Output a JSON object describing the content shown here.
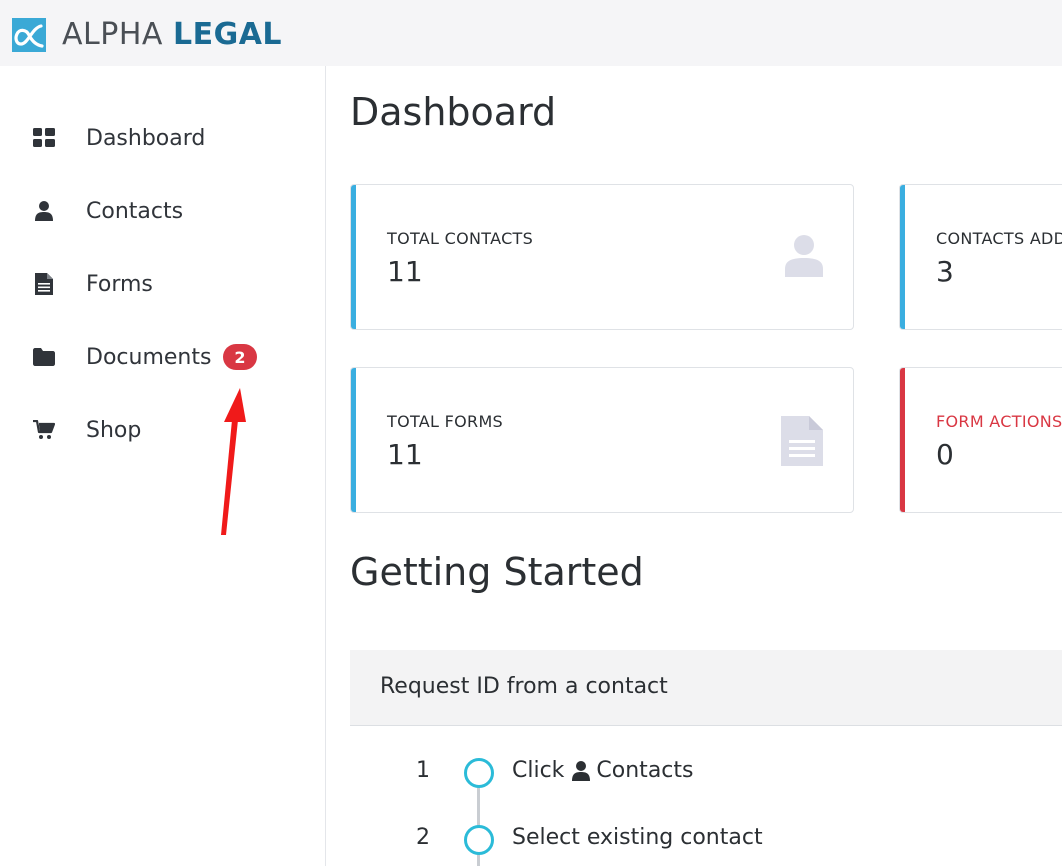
{
  "brand": {
    "name_light": "ALPHA",
    "name_bold": "LEGAL",
    "accent": "#1a6a93",
    "logo_bg": "#3aa9d6"
  },
  "sidebar": {
    "items": [
      {
        "label": "Dashboard",
        "icon": "grid-icon"
      },
      {
        "label": "Contacts",
        "icon": "user-icon"
      },
      {
        "label": "Forms",
        "icon": "document-icon"
      },
      {
        "label": "Documents",
        "icon": "folder-icon",
        "badge": "2"
      },
      {
        "label": "Shop",
        "icon": "cart-icon"
      }
    ]
  },
  "main": {
    "title": "Dashboard",
    "cards": [
      {
        "label": "TOTAL CONTACTS",
        "value": "11",
        "accent": "#3aaee0",
        "icon": "user-icon"
      },
      {
        "label": "CONTACTS ADD",
        "value": "3",
        "accent": "#3aaee0"
      },
      {
        "label": "TOTAL FORMS",
        "value": "11",
        "accent": "#3aaee0",
        "icon": "document-icon"
      },
      {
        "label": "FORM ACTIONS",
        "value": "0",
        "accent": "#d93743",
        "label_color": "#d93743"
      }
    ],
    "getting_started": {
      "title": "Getting Started",
      "panel_title": "Request ID from a contact",
      "steps": [
        {
          "num": "1",
          "prefix": "Click",
          "icon": "user-icon",
          "text": "Contacts"
        },
        {
          "num": "2",
          "text": "Select existing contact"
        }
      ]
    }
  },
  "annotation": {
    "type": "red-arrow",
    "color": "#f01a1a",
    "target": "documents-badge"
  }
}
